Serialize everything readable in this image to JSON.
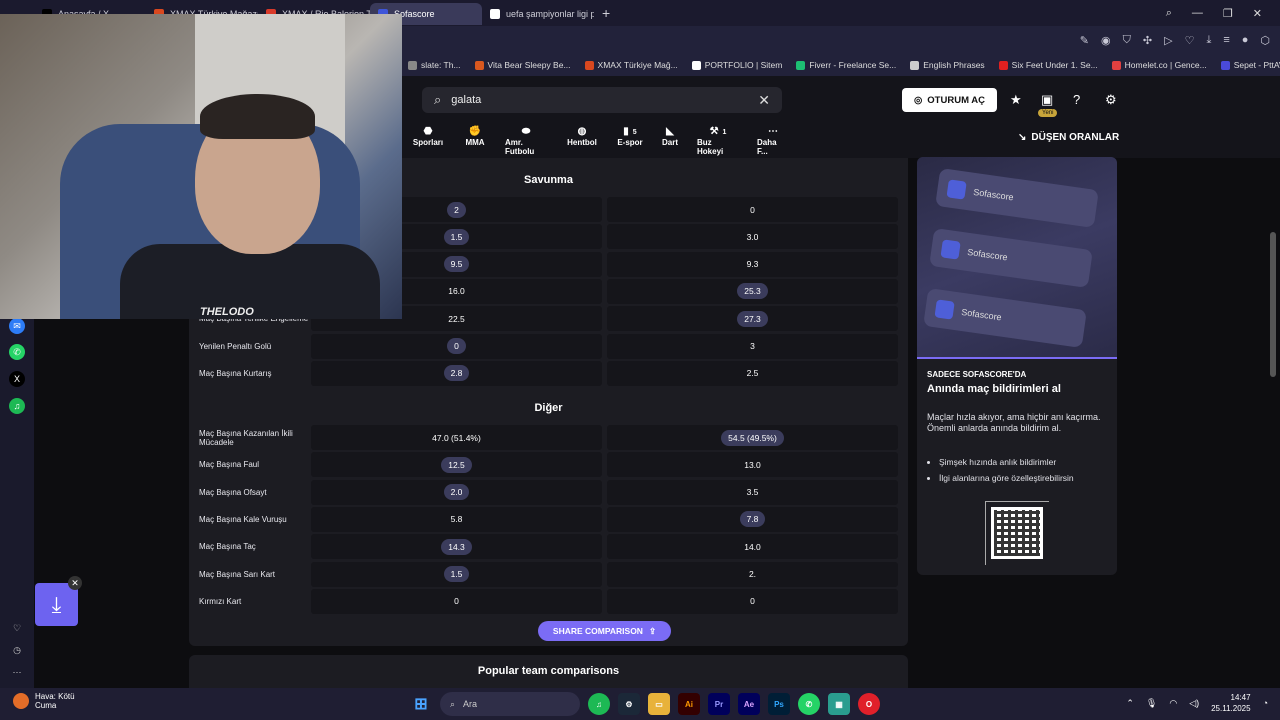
{
  "browser": {
    "tabs": [
      {
        "label": "Anasayfa / X",
        "color": "#000000"
      },
      {
        "label": "XMAX Türkiye Mağazası |",
        "color": "#d9481f"
      },
      {
        "label": "XMAX / Rio Balerion Terlik",
        "color": "#d93a2a"
      },
      {
        "label": "Sofascore",
        "color": "#3e55d9",
        "active": true
      },
      {
        "label": "uefa şampiyonlar ligi puan",
        "color": "#ffffff"
      }
    ],
    "new_tab": "+",
    "bookmarks": [
      {
        "label": "slate: Th...",
        "color": "#888888"
      },
      {
        "label": "Vita Bear Sleepy Be...",
        "color": "#d9581f"
      },
      {
        "label": "XMAX Türkiye Mağ...",
        "color": "#d9481f"
      },
      {
        "label": "PORTFOLIO | Sitem",
        "color": "#ffffff"
      },
      {
        "label": "Fiverr - Freelance Se...",
        "color": "#1dbf73"
      },
      {
        "label": "English Phrases",
        "color": "#cccccc"
      },
      {
        "label": "Six Feet Under 1. Se...",
        "color": "#e02020"
      },
      {
        "label": "Homelet.co | Gence...",
        "color": "#e04040"
      },
      {
        "label": "Sepet - PttAVM",
        "color": "#4a4ad9"
      }
    ]
  },
  "header": {
    "search_value": "galata",
    "login_label": "OTURUM AÇ",
    "yeni_badge": "Yeni",
    "sports": [
      {
        "label": "Sporları",
        "count": ""
      },
      {
        "label": "MMA",
        "count": ""
      },
      {
        "label": "Amr. Futbolu",
        "count": ""
      },
      {
        "label": "Hentbol",
        "count": ""
      },
      {
        "label": "E-spor",
        "count": "5"
      },
      {
        "label": "Dart",
        "count": ""
      },
      {
        "label": "Buz Hokeyi",
        "count": "1"
      },
      {
        "label": "Daha F...",
        "count": ""
      }
    ],
    "dusen_oranlar": "DÜŞEN ORANLAR"
  },
  "savunma": {
    "title": "Savunma",
    "rows": [
      {
        "label": "",
        "left": "2",
        "right": "0",
        "hl": "left"
      },
      {
        "label": "",
        "left": "1.5",
        "right": "3.0",
        "hl": "left"
      },
      {
        "label": "",
        "left": "9.5",
        "right": "9.3",
        "hl": "left"
      },
      {
        "label": "",
        "left": "16.0",
        "right": "25.3",
        "hl": "right"
      },
      {
        "label": "Maç Başına Tehlike Engelleme",
        "left": "22.5",
        "right": "27.3",
        "hl": "right"
      },
      {
        "label": "Yenilen Penaltı Golü",
        "left": "0",
        "right": "3",
        "hl": "left"
      },
      {
        "label": "Maç Başına Kurtarış",
        "left": "2.8",
        "right": "2.5",
        "hl": "left"
      }
    ]
  },
  "diger": {
    "title": "Diğer",
    "rows": [
      {
        "label": "Maç Başına Kazanılan İkili Mücadele",
        "left": "47.0 (51.4%)",
        "right": "54.5 (49.5%)",
        "hl": "right"
      },
      {
        "label": "Maç Başına Faul",
        "left": "12.5",
        "right": "13.0",
        "hl": "left"
      },
      {
        "label": "Maç Başına Ofsayt",
        "left": "2.0",
        "right": "3.5",
        "hl": "left"
      },
      {
        "label": "Maç Başına Kale Vuruşu",
        "left": "5.8",
        "right": "7.8",
        "hl": "right"
      },
      {
        "label": "Maç Başına Taç",
        "left": "14.3",
        "right": "14.0",
        "hl": "left"
      },
      {
        "label": "Maç Başına Sarı Kart",
        "left": "1.5",
        "right": "2.",
        "hl": "left"
      },
      {
        "label": "Kırmızı Kart",
        "left": "0",
        "right": "0",
        "hl": "none"
      }
    ]
  },
  "share_label": "SHARE COMPARISON",
  "popular_title": "Popular team comparisons",
  "promo": {
    "brand1": "Sofascore",
    "brand2": "Sofascore",
    "brand3": "Sofascore",
    "kicker": "SADECE SOFASCORE'DA",
    "title": "Anında maç bildirimleri al",
    "desc": "Maçlar hızla akıyor, ama hiçbir anı kaçırma. Önemli anlarda anında bildirim al.",
    "bullets": [
      "Şimşek hızında anlık bildirimler",
      "İlgi alanlarına göre özelleştirebilirsin"
    ]
  },
  "webcam": {
    "shirt_text": "THELODO"
  },
  "taskbar": {
    "weather_line1": "Hava: Kötü",
    "weather_line2": "Cuma",
    "search_placeholder": "Ara",
    "time": "14:47",
    "date": "25.11.2025"
  }
}
